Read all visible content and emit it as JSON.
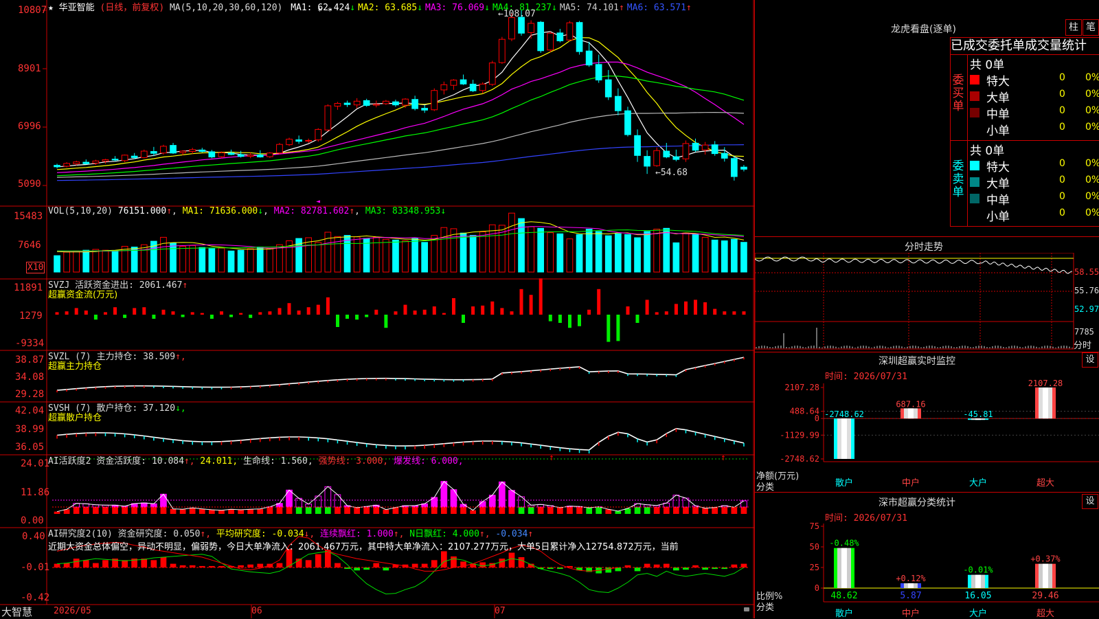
{
  "header": {
    "star": "★",
    "stock_name": "华亚智能",
    "period": "(日线，前复权)",
    "ma_label": "MA(5,10,20,30,60,120)",
    "ma_items": [
      {
        "label": "MA1:",
        "value": "62.424",
        "arrow": "↓",
        "color": "#ffffff"
      },
      {
        "label": "MA2:",
        "value": "63.685",
        "arrow": "↓",
        "color": "#ffff00"
      },
      {
        "label": "MA3:",
        "value": "76.069",
        "arrow": "↓",
        "color": "#ff00ff"
      },
      {
        "label": "MA4:",
        "value": "81.237",
        "arrow": "↓",
        "color": "#00ff00"
      },
      {
        "label": "MA5:",
        "value": "74.101",
        "arrow": "↑",
        "color": "#cccccc"
      },
      {
        "label": "MA6:",
        "value": "63.571",
        "arrow": "↑",
        "color": "#3355ff"
      }
    ],
    "stars": "* *"
  },
  "price_panel": {
    "y_ticks": [
      "10807",
      "8901",
      "6996",
      "5090"
    ],
    "high_label": "←108.07",
    "low_label": "←54.68"
  },
  "vol_panel": {
    "title": "VOL(5,10,20)",
    "value": "76151.000",
    "value_arrow": "↑",
    "ma1": "MA1: 71636.000",
    "ma1_arrow": "↓",
    "ma2": "MA2: 82781.602",
    "ma2_arrow": "↑",
    "ma3": "MA3: 83348.953",
    "ma3_arrow": "↓",
    "y_ticks": [
      "15483",
      "7646"
    ],
    "unit": "X10"
  },
  "svzj_panel": {
    "title": "SVZJ  活跃资金进出: 2061.467",
    "arrow": "↑",
    "subtitle": "超赢资金流(万元)",
    "y_ticks": [
      "11891",
      "1279",
      "-9334"
    ]
  },
  "svzl_panel": {
    "title": "SVZL (7) 主力持仓: 38.509",
    "arrow": "↑,",
    "subtitle": "超赢主力持仓",
    "y_ticks": [
      "38.87",
      "34.08",
      "29.28"
    ]
  },
  "svsh_panel": {
    "title": "SVSH (7) 散户持仓: 37.120",
    "arrow": "↓,",
    "subtitle": "超赢散户持仓",
    "y_ticks": [
      "42.04",
      "38.99",
      "36.05"
    ]
  },
  "ai_active_panel": {
    "title": "AI活跃度2 资金活跃度: 10.084",
    "v2": "24.011,",
    "life": "生命线: 1.560,",
    "strong": "强势线: 3.000,",
    "burst": "爆发线: 6.000,",
    "y_ticks": [
      "24.01",
      "11.86",
      "0.00"
    ]
  },
  "ai_research_panel": {
    "title": "AI研究度2(10)",
    "degree": "资金研究度: 0.050",
    "avg": "平均研究度: -0.034",
    "red": "连续飘红: 1.000",
    "nred": "N日飘红: 4.000",
    "last": "-0.034",
    "summary": "近期大资金总体偏空，异动不明显，偏弱势，今日大单净流入：2061.467万元，其中特大单净流入：2107.277万元，大单5日累计净入12754.872万元，当前",
    "y_ticks": [
      "0.40",
      "-0.01",
      "-0.42"
    ]
  },
  "x_axis": {
    "labels": [
      "2026/05",
      "06",
      "07"
    ],
    "brand": "大智慧"
  },
  "right_panel": {
    "lhb_title": "龙虎看盘(逐单)",
    "btn_bar": "柱",
    "btn_pen": "笔",
    "tabs": [
      "已成交",
      "委托单",
      "成交量统计"
    ],
    "buy_label": "委买单",
    "sell_label": "委卖单",
    "buy_total": "共 0单",
    "sell_total": "共 0单",
    "buy_rows": [
      {
        "name": "特大",
        "count": "0",
        "pct": "0%",
        "color": "#ff0000"
      },
      {
        "name": "大单",
        "count": "0",
        "pct": "0%",
        "color": "#aa0000"
      },
      {
        "name": "中单",
        "count": "0",
        "pct": "0%",
        "color": "#770000"
      },
      {
        "name": "小单",
        "count": "0",
        "pct": "0%",
        "color": "#000000"
      }
    ],
    "sell_rows": [
      {
        "name": "特大",
        "count": "0",
        "pct": "0%",
        "color": "#00ffff"
      },
      {
        "name": "大单",
        "count": "0",
        "pct": "0%",
        "color": "#008888"
      },
      {
        "name": "中单",
        "count": "0",
        "pct": "0%",
        "color": "#006666"
      },
      {
        "name": "小单",
        "count": "0",
        "pct": "0%",
        "color": "#000000"
      }
    ],
    "intraday_title": "分时走势",
    "intraday_ticks": [
      "58.55",
      "55.76",
      "52.97"
    ],
    "intraday_vol": "7785",
    "intraday_unit": "分时",
    "sz_title": "深圳超赢实时监控",
    "sz_time": "时间: 2026/07/31",
    "sz_ticks": [
      "2107.28",
      "488.64",
      "0",
      "-1129.99",
      "-2748.62"
    ],
    "sz_ylabel": "净额(万元)",
    "sz_xlabel": "分类",
    "sz_set": "设",
    "sz_bars": [
      {
        "cat": "散户",
        "value": "-2748.62",
        "color": "#00ffff"
      },
      {
        "cat": "中户",
        "value": "687.16",
        "color": "#ff4444"
      },
      {
        "cat": "大户",
        "value": "-45.81",
        "color": "#00ffff"
      },
      {
        "cat": "超大",
        "value": "2107.28",
        "color": "#ff4444"
      }
    ],
    "sc_title": "深市超赢分类统计",
    "sc_time": "时间: 2026/07/31",
    "sc_ticks": [
      "75",
      "50",
      "25",
      "0"
    ],
    "sc_ylabel": "比例%",
    "sc_xlabel": "分类",
    "sc_set": "设",
    "sc_bars": [
      {
        "cat": "散户",
        "value": "48.62",
        "change": "-0.48%"
      },
      {
        "cat": "中户",
        "value": "5.87",
        "change": "+0.12%"
      },
      {
        "cat": "大户",
        "value": "16.05",
        "change": "-0.01%"
      },
      {
        "cat": "超大",
        "value": "29.46",
        "change": "+0.37%"
      }
    ]
  },
  "chart_data": [
    {
      "type": "candlestick",
      "title": "华亚智能(日线，前复权)",
      "ylim": [
        50.9,
        108.07
      ],
      "candles": [
        [
          57.5,
          58.0,
          56.5,
          57.0
        ],
        [
          57.2,
          58.5,
          56.8,
          58.1
        ],
        [
          58.0,
          59.0,
          57.5,
          58.6
        ],
        [
          58.5,
          59.4,
          57.8,
          58.0
        ],
        [
          58.2,
          59.3,
          57.6,
          58.9
        ],
        [
          58.8,
          59.6,
          58.0,
          59.3
        ],
        [
          59.5,
          60.5,
          58.8,
          59.2
        ],
        [
          59.0,
          61.0,
          58.5,
          60.8
        ],
        [
          60.5,
          61.5,
          59.5,
          60.0
        ],
        [
          60.0,
          62.6,
          59.8,
          62.1
        ],
        [
          62.0,
          63.5,
          60.5,
          61.4
        ],
        [
          61.5,
          64.2,
          61.0,
          63.7
        ],
        [
          64.0,
          64.8,
          61.2,
          61.5
        ],
        [
          61.6,
          62.4,
          60.8,
          62.1
        ],
        [
          62.0,
          63.2,
          61.2,
          62.6
        ],
        [
          62.5,
          63.2,
          61.7,
          62.0
        ],
        [
          61.9,
          62.5,
          59.8,
          60.2
        ],
        [
          60.3,
          62.0,
          59.8,
          61.6
        ],
        [
          61.5,
          62.6,
          60.8,
          61.0
        ],
        [
          61.0,
          62.2,
          60.0,
          60.4
        ],
        [
          60.4,
          61.6,
          59.8,
          60.8
        ],
        [
          60.9,
          62.4,
          60.0,
          60.2
        ],
        [
          60.3,
          61.8,
          59.9,
          61.5
        ],
        [
          61.5,
          64.8,
          61.0,
          64.3
        ],
        [
          64.2,
          66.5,
          63.8,
          66.0
        ],
        [
          65.8,
          67.2,
          64.5,
          65.3
        ],
        [
          65.4,
          66.2,
          64.8,
          65.6
        ],
        [
          65.8,
          69.6,
          65.2,
          69.2
        ],
        [
          69.0,
          77.4,
          68.6,
          76.9
        ],
        [
          76.8,
          78.2,
          75.6,
          77.7
        ],
        [
          77.8,
          78.6,
          76.5,
          77.3
        ],
        [
          77.2,
          79.4,
          76.1,
          78.4
        ],
        [
          78.6,
          79.2,
          76.6,
          77.0
        ],
        [
          77.1,
          78.6,
          76.4,
          77.4
        ],
        [
          77.6,
          78.8,
          77.2,
          78.4
        ],
        [
          78.2,
          78.9,
          76.6,
          77.2
        ],
        [
          77.1,
          79.4,
          76.2,
          79.1
        ],
        [
          79.0,
          80.2,
          75.4,
          76.0
        ],
        [
          76.1,
          77.2,
          74.6,
          75.5
        ],
        [
          75.6,
          82.6,
          75.2,
          81.9
        ],
        [
          82.1,
          84.8,
          80.6,
          83.8
        ],
        [
          83.6,
          85.6,
          82.1,
          85.3
        ],
        [
          85.4,
          87.1,
          83.7,
          84.0
        ],
        [
          84.0,
          85.4,
          81.4,
          81.8
        ],
        [
          81.9,
          84.6,
          80.9,
          84.0
        ],
        [
          83.9,
          91.6,
          83.4,
          90.9
        ],
        [
          91.0,
          99.4,
          90.6,
          98.6
        ],
        [
          98.7,
          107.1,
          98.0,
          105.7
        ],
        [
          105.8,
          108.07,
          99.8,
          100.6
        ],
        [
          100.8,
          104.8,
          98.8,
          103.8
        ],
        [
          104.2,
          104.6,
          94.2,
          94.9
        ],
        [
          95.1,
          101.1,
          94.4,
          100.6
        ],
        [
          100.7,
          102.0,
          97.6,
          98.1
        ],
        [
          98.4,
          104.6,
          98.0,
          104.0
        ],
        [
          104.1,
          104.6,
          93.6,
          94.6
        ],
        [
          94.8,
          97.8,
          89.6,
          90.2
        ],
        [
          90.4,
          93.6,
          84.4,
          85.3
        ],
        [
          85.4,
          88.6,
          78.8,
          79.8
        ],
        [
          80.0,
          82.6,
          73.8,
          75.3
        ],
        [
          75.3,
          76.6,
          66.9,
          67.5
        ],
        [
          67.2,
          69.2,
          58.6,
          60.7
        ],
        [
          60.4,
          62.4,
          54.68,
          57.2
        ],
        [
          57.4,
          63.3,
          57.0,
          62.3
        ],
        [
          62.1,
          64.8,
          59.8,
          60.2
        ],
        [
          60.3,
          62.6,
          58.8,
          59.4
        ],
        [
          59.6,
          65.6,
          58.6,
          64.6
        ],
        [
          64.7,
          66.2,
          61.8,
          62.4
        ],
        [
          62.5,
          65.1,
          61.0,
          64.1
        ],
        [
          64.2,
          65.4,
          60.6,
          61.3
        ],
        [
          61.4,
          63.4,
          58.7,
          59.8
        ],
        [
          59.7,
          60.6,
          52.5,
          53.8
        ],
        [
          56.9,
          57.6,
          55.5,
          56.2
        ]
      ]
    },
    {
      "type": "bar",
      "title": "VOL(5,10,20)",
      "ylim": [
        0,
        15483
      ],
      "values": [
        4200,
        5100,
        5400,
        5600,
        5800,
        5600,
        5500,
        6600,
        6400,
        7000,
        7900,
        8900,
        7500,
        6600,
        6800,
        6300,
        6000,
        6100,
        5400,
        5600,
        6000,
        6400,
        6100,
        7000,
        8000,
        8600,
        8800,
        7600,
        10200,
        9100,
        9400,
        9000,
        8600,
        8900,
        8400,
        8200,
        8000,
        8600,
        7600,
        9400,
        11400,
        11100,
        10000,
        9400,
        10300,
        12100,
        12000,
        15100,
        13700,
        11600,
        11200,
        10100,
        9800,
        8500,
        9600,
        11000,
        10400,
        9300,
        9800,
        9600,
        8800,
        10400,
        11000,
        11200,
        7500,
        10000,
        9800,
        8900,
        8200,
        8000,
        8400,
        7615
      ],
      "up_color": "#ff0000",
      "down_color": "#00ffff"
    }
  ]
}
